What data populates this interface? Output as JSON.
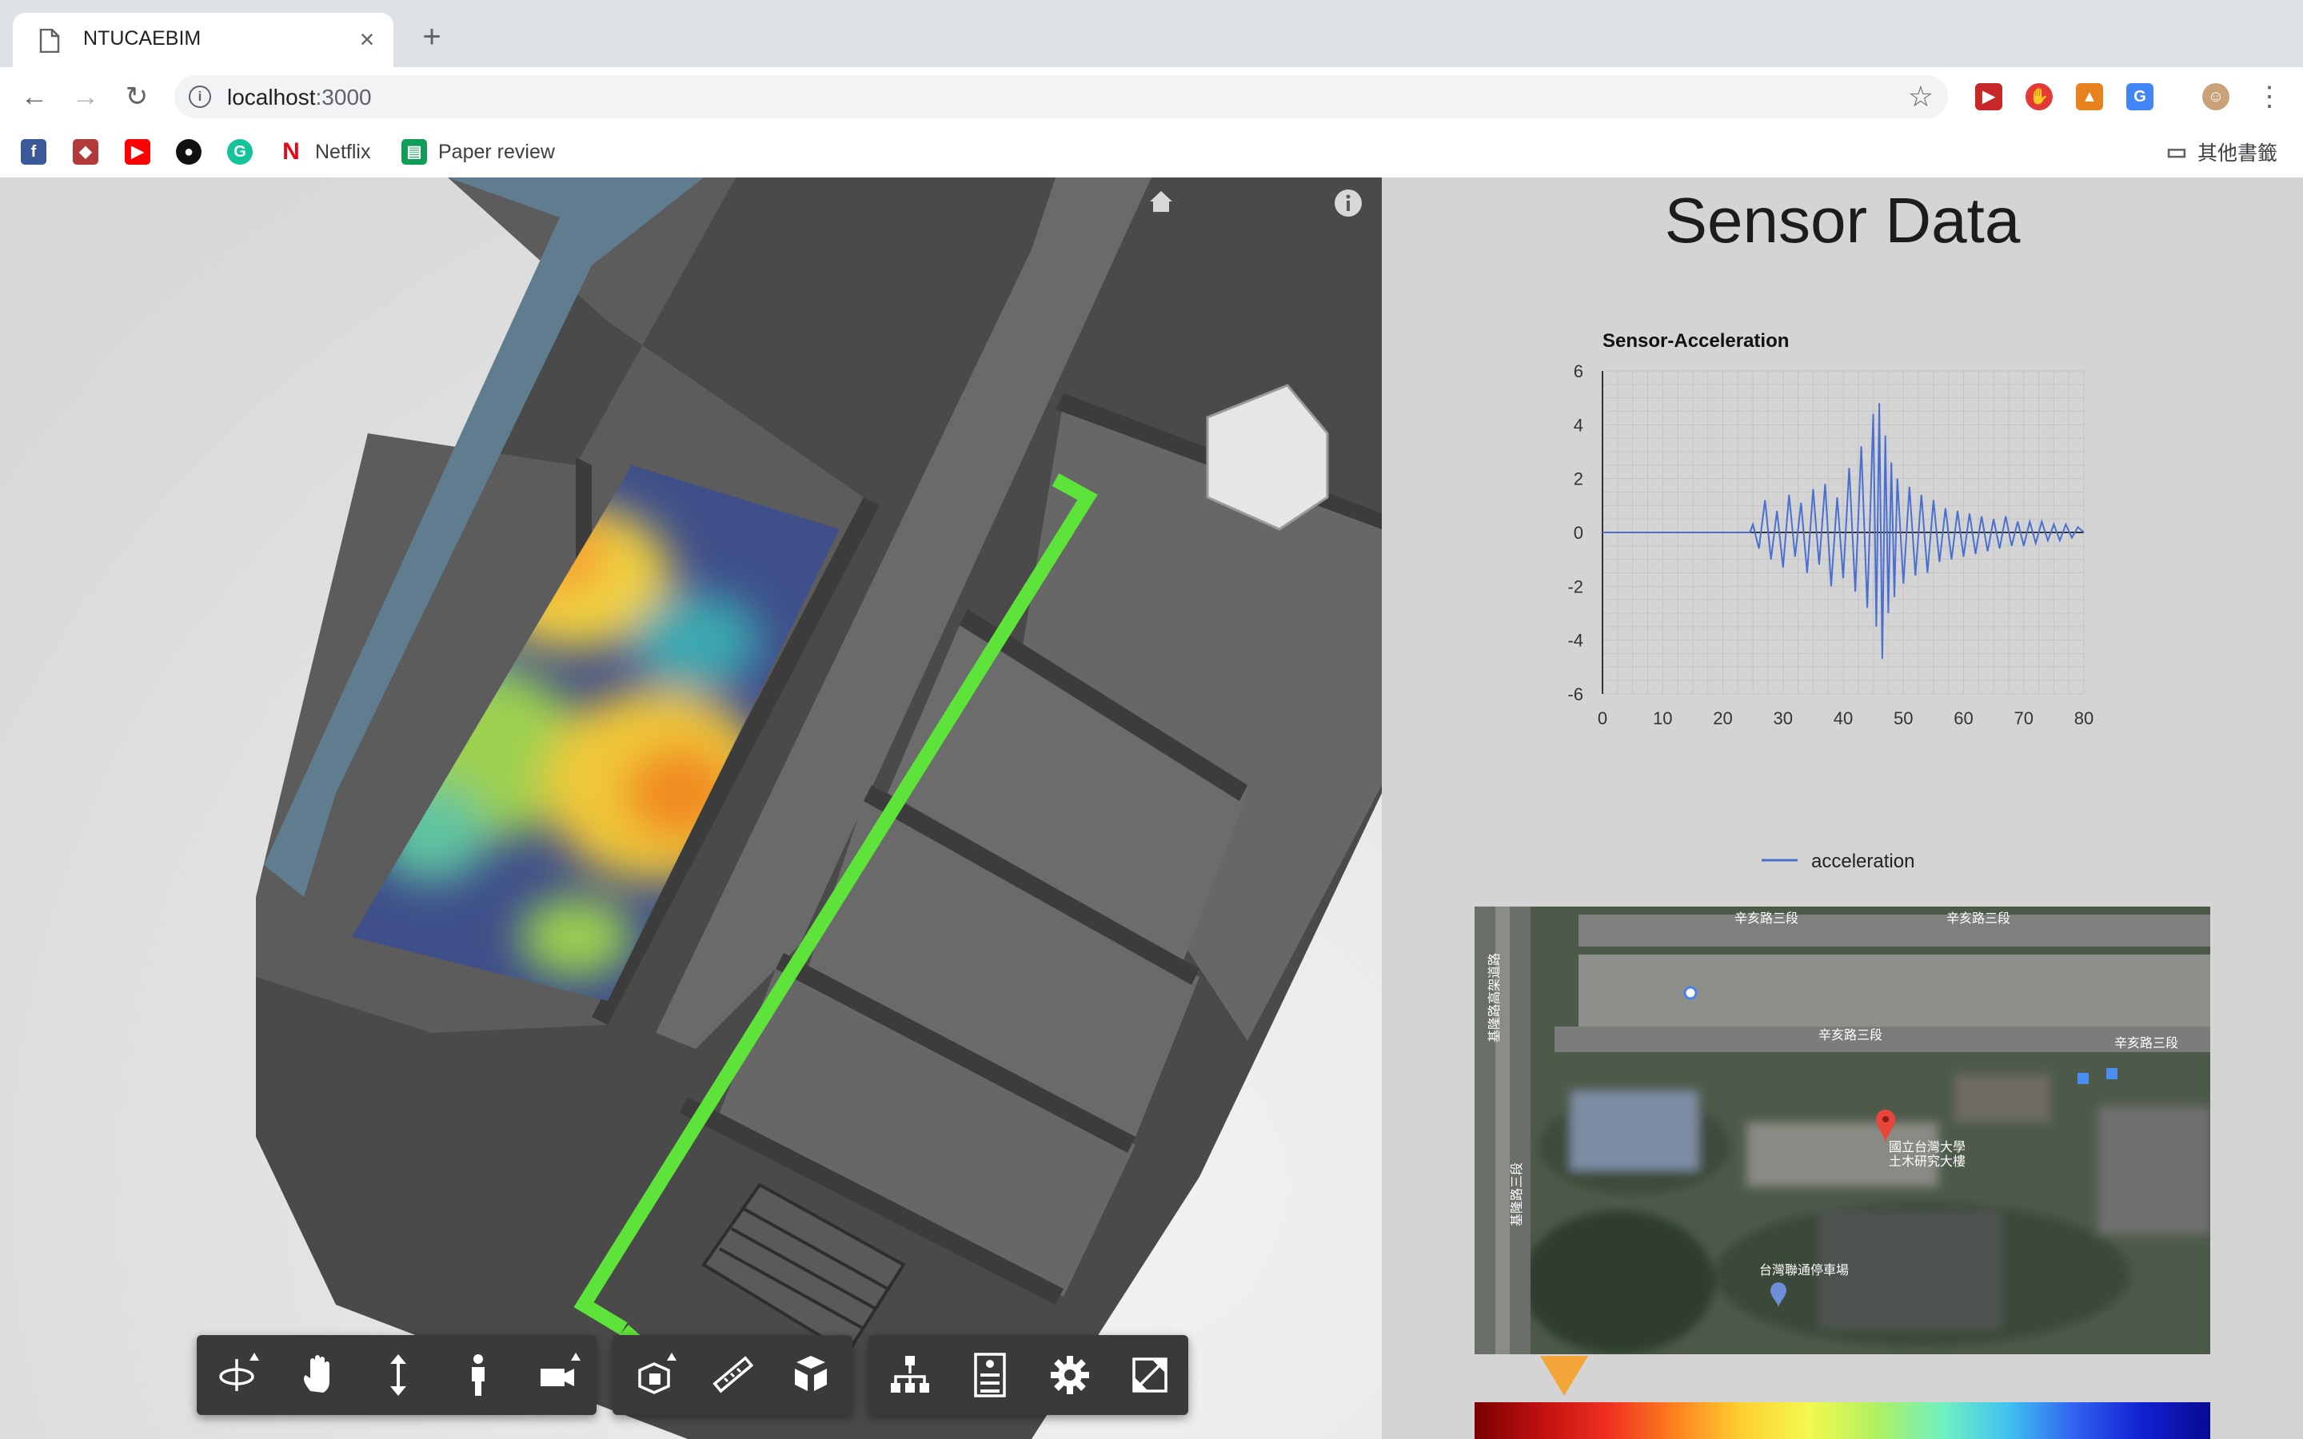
{
  "browser": {
    "tab_title": "NTUCAEBIM",
    "url_host": "localhost",
    "url_port": ":3000",
    "bookmarks": [
      {
        "label": "",
        "icon": "facebook-icon"
      },
      {
        "label": "",
        "icon": "crest-icon"
      },
      {
        "label": "",
        "icon": "youtube-icon"
      },
      {
        "label": "",
        "icon": "github-icon"
      },
      {
        "label": "",
        "icon": "grammarly-icon"
      },
      {
        "label": "Netflix",
        "icon": "netflix-icon"
      },
      {
        "label": "Paper review",
        "icon": "sheets-icon"
      }
    ],
    "other_bookmarks": "其他書籤"
  },
  "panel": {
    "title": "Sensor Data"
  },
  "chart_data": {
    "type": "line",
    "title": "Sensor-Acceleration",
    "xlabel": "",
    "ylabel": "",
    "xlim": [
      0,
      80
    ],
    "ylim": [
      -6,
      6
    ],
    "x_ticks": [
      "0",
      "10",
      "20",
      "30",
      "40",
      "50",
      "60",
      "70",
      "80"
    ],
    "y_ticks": [
      "6",
      "4",
      "2",
      "0",
      "-2",
      "-4",
      "-6"
    ],
    "grid": true,
    "legend": "bottom",
    "series": [
      {
        "name": "acceleration",
        "color": "#4a6fd0",
        "x": [
          0,
          24.5,
          25,
          26,
          27,
          28,
          29,
          30,
          31,
          32,
          33,
          34,
          35,
          36,
          37,
          38,
          39,
          40,
          41,
          42,
          43,
          44,
          45,
          45.5,
          46,
          46.5,
          47,
          47.5,
          48,
          48.5,
          49,
          50,
          51,
          52,
          53,
          54,
          55,
          56,
          57,
          58,
          59,
          60,
          61,
          62,
          63,
          64,
          65,
          66,
          67,
          68,
          69,
          70,
          71,
          72,
          73,
          74,
          75,
          76,
          77,
          78,
          79,
          80
        ],
        "y": [
          0,
          0,
          0.3,
          -0.6,
          1.2,
          -1.0,
          0.8,
          -1.3,
          1.4,
          -0.9,
          1.1,
          -1.5,
          1.6,
          -1.2,
          1.8,
          -2.0,
          1.3,
          -1.7,
          2.4,
          -2.2,
          3.2,
          -2.8,
          4.4,
          -3.5,
          4.8,
          -4.7,
          3.6,
          -3.0,
          2.6,
          -2.4,
          2.0,
          -1.9,
          1.7,
          -1.6,
          1.4,
          -1.5,
          1.2,
          -1.1,
          0.9,
          -1.0,
          0.8,
          -0.9,
          0.7,
          -0.8,
          0.6,
          -0.7,
          0.5,
          -0.6,
          0.6,
          -0.5,
          0.4,
          -0.5,
          0.4,
          -0.4,
          0.4,
          -0.3,
          0.3,
          -0.3,
          0.3,
          -0.2,
          0.2,
          0
        ]
      }
    ]
  },
  "map": {
    "road_labels": [
      "辛亥路三段",
      "辛亥路三段",
      "辛亥路三段",
      "辛亥路三段",
      "基隆路三段",
      "基隆路高架道路"
    ],
    "pin_label_line1": "國立台灣大學",
    "pin_label_line2": "土木研究大樓",
    "parking_label": "台灣聯通停車場"
  },
  "toolbar": {
    "icons": [
      "orbit-icon",
      "pan-icon",
      "zoom-icon",
      "first-person-icon",
      "camera-icon",
      "section-icon",
      "measure-icon",
      "explode-icon",
      "model-browser-icon",
      "properties-icon",
      "settings-icon",
      "fullscreen-icon"
    ]
  },
  "colors": {
    "path_green": "#5ee33a",
    "accent_marker": "#f4a53a"
  }
}
